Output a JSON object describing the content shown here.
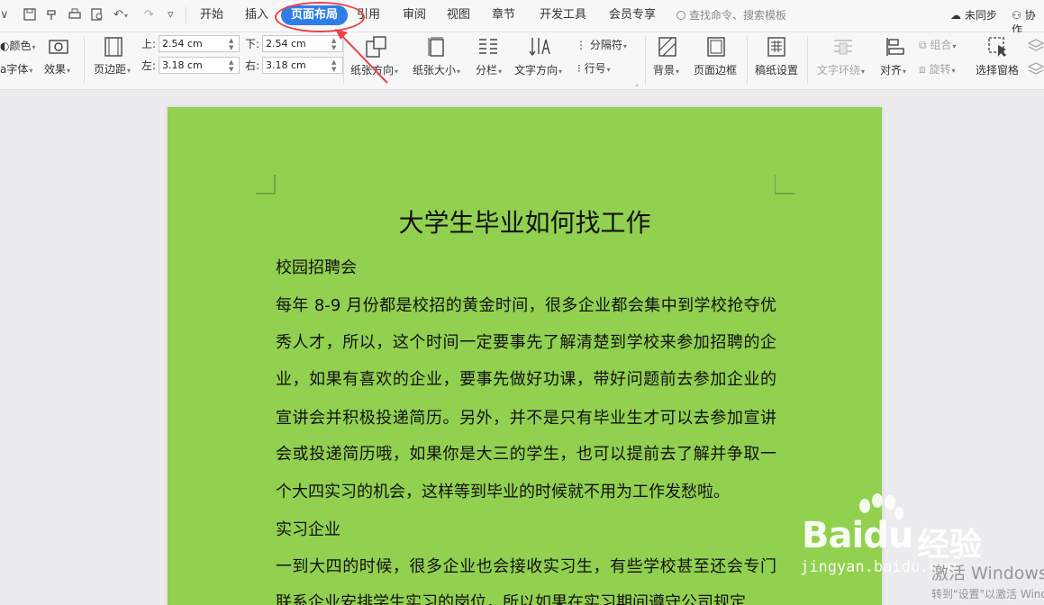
{
  "menubar": {
    "tabs": [
      "开始",
      "插入",
      "页面布局",
      "引用",
      "审阅",
      "视图",
      "章节",
      "开发工具",
      "会员专享"
    ],
    "active_tab": "页面布局",
    "search_placeholder": "查找命令、搜索模板",
    "sync_label": "未同步",
    "collab_label": "协作"
  },
  "ribbon": {
    "color_label": "颜色",
    "font_label": "字体",
    "effect_label": "效果",
    "margin_label": "页边距",
    "margins": {
      "top_label": "上:",
      "top_value": "2.54 cm",
      "bottom_label": "下:",
      "bottom_value": "2.54 cm",
      "left_label": "左:",
      "left_value": "3.18 cm",
      "right_label": "右:",
      "right_value": "3.18 cm"
    },
    "orientation_label": "纸张方向",
    "size_label": "纸张大小",
    "columns_label": "分栏",
    "text_direction_label": "文字方向",
    "separator_label": "分隔符",
    "line_number_label": "行号",
    "background_label": "背景",
    "page_border_label": "页面边框",
    "paper_setup_label": "稿纸设置",
    "text_wrap_label": "文字环绕",
    "align_label": "对齐",
    "group_label": "组合",
    "rotate_label": "旋转",
    "selection_pane_label": "选择窗格"
  },
  "document": {
    "page_color": "#92d050",
    "title": "大学生毕业如何找工作",
    "heading1": "校园招聘会",
    "para1_lines": [
      "每年 8-9 月份都是校招的黄金时间，很多企业都会集中到学校抢夺优",
      "秀人才，所以，这个时间一定要事先了解清楚到学校来参加招聘的企",
      "业，如果有喜欢的企业，要事先做好功课，带好问题前去参加企业的",
      "宣讲会并积极投递简历。另外，并不是只有毕业生才可以去参加宣讲",
      "会或投递简历哦，如果你是大三的学生，也可以提前去了解并争取一",
      "个大四实习的机会，这样等到毕业的时候就不用为工作发愁啦。"
    ],
    "heading2": "实习企业",
    "para2_lines": [
      "一到大四的时候，很多企业也会接收实习生，有些学校甚至还会专门",
      "联系企业安排学生实习的岗位，所以如果在实习期间遵守公司规定"
    ]
  },
  "watermark": {
    "baidu_logo": "Bai",
    "baidu_logo2": "du",
    "baidu_cn": "经验",
    "baidu_url": "jingyan.baidu.com",
    "win_activate": "激活 Windows",
    "win_activate_hint": "转到\"设置\"以激活 Windows"
  },
  "colors": {
    "accent": "#2f7ee8",
    "annotation": "#e8434a",
    "page": "#92d050"
  }
}
